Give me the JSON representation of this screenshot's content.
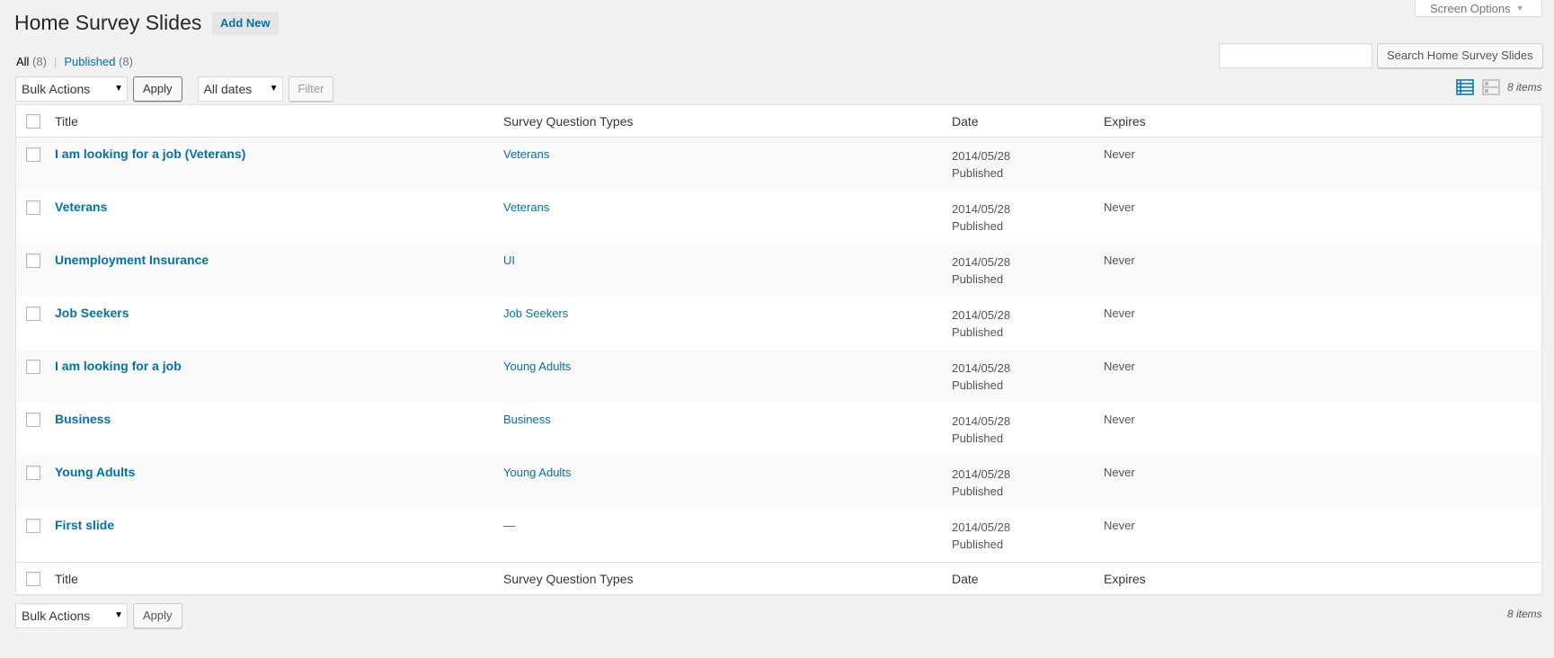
{
  "screen_options": {
    "label": "Screen Options"
  },
  "page": {
    "title": "Home Survey Slides",
    "add_new_label": "Add New"
  },
  "filters": {
    "all_label": "All",
    "all_count": "(8)",
    "published_label": "Published",
    "published_count": "(8)"
  },
  "search": {
    "button_label": "Search Home Survey Slides",
    "value": ""
  },
  "actions": {
    "bulk_actions": "Bulk Actions",
    "apply_label": "Apply",
    "dates": "All dates",
    "filter_label": "Filter"
  },
  "items_count": "8 items",
  "table": {
    "columns": {
      "title": "Title",
      "types": "Survey Question Types",
      "date": "Date",
      "expires": "Expires"
    },
    "rows": [
      {
        "title": "I am looking for a job (Veterans)",
        "types": "Veterans",
        "date": "2014/05/28",
        "status": "Published",
        "expires": "Never"
      },
      {
        "title": "Veterans",
        "types": "Veterans",
        "date": "2014/05/28",
        "status": "Published",
        "expires": "Never"
      },
      {
        "title": "Unemployment Insurance",
        "types": "UI",
        "date": "2014/05/28",
        "status": "Published",
        "expires": "Never"
      },
      {
        "title": "Job Seekers",
        "types": "Job Seekers",
        "date": "2014/05/28",
        "status": "Published",
        "expires": "Never"
      },
      {
        "title": "I am looking for a job",
        "types": "Young Adults",
        "date": "2014/05/28",
        "status": "Published",
        "expires": "Never"
      },
      {
        "title": "Business",
        "types": "Business",
        "date": "2014/05/28",
        "status": "Published",
        "expires": "Never"
      },
      {
        "title": "Young Adults",
        "types": "Young Adults",
        "date": "2014/05/28",
        "status": "Published",
        "expires": "Never"
      },
      {
        "title": "First slide",
        "types": "—",
        "date": "2014/05/28",
        "status": "Published",
        "expires": "Never"
      }
    ]
  },
  "icons": {
    "list_view": "list-view-icon",
    "excerpt_view": "excerpt-view-icon",
    "dropdown": "caret-down-icon"
  },
  "colors": {
    "link": "#0073aa",
    "background": "#f1f1f1"
  }
}
